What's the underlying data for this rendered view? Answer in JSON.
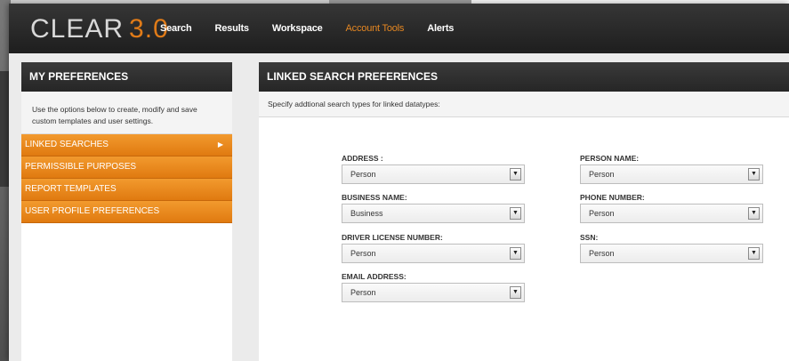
{
  "app": {
    "logo_text": "CLEAR",
    "logo_version": "3.0"
  },
  "nav": {
    "items": [
      {
        "label": "Search"
      },
      {
        "label": "Results"
      },
      {
        "label": "Workspace"
      },
      {
        "label": "Account Tools"
      },
      {
        "label": "Alerts"
      }
    ],
    "active": "Account Tools",
    "accent_color": "#e58722"
  },
  "left_panel": {
    "title": "MY PREFERENCES",
    "description": "Use the options below to create, modify and save custom templates and user settings.",
    "items": [
      {
        "label": "LINKED SEARCHES",
        "selected": true
      },
      {
        "label": "PERMISSIBLE PURPOSES"
      },
      {
        "label": "REPORT TEMPLATES"
      },
      {
        "label": "USER PROFILE PREFERENCES"
      }
    ],
    "item_color": "#ea8a1f"
  },
  "right_panel": {
    "title": "LINKED SEARCH PREFERENCES",
    "description": "Specify addtional search types for linked datatypes:",
    "fields": {
      "address": {
        "label": "ADDRESS :",
        "value": "Person"
      },
      "business_name": {
        "label": "BUSINESS NAME:",
        "value": "Business"
      },
      "driver_license": {
        "label": "DRIVER LICENSE NUMBER:",
        "value": "Person"
      },
      "email": {
        "label": "EMAIL ADDRESS:",
        "value": "Person"
      },
      "person_name": {
        "label": "PERSON NAME:",
        "value": "Person"
      },
      "phone_number": {
        "label": "PHONE NUMBER:",
        "value": "Person"
      },
      "ssn": {
        "label": "SSN:",
        "value": "Person"
      }
    }
  },
  "icons": {
    "dropdown": "chevron-down-icon",
    "selected_arrow": "chevron-right-icon"
  }
}
